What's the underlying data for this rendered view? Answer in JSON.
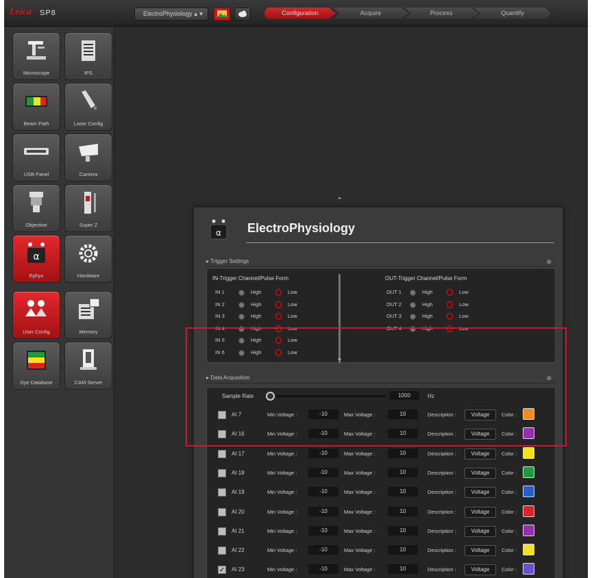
{
  "topbar": {
    "brand": "Leica",
    "model": "SP8",
    "project": "ElectroPhysiology",
    "tabs": [
      "Configuration",
      "Acquire",
      "Process",
      "Quantify"
    ],
    "icons": {
      "photo": "photo-icon",
      "cloud": "cloud-icon"
    }
  },
  "sidebar": {
    "tiles": [
      {
        "label": "Microscope",
        "icon": "microscope-icon"
      },
      {
        "label": "IPS",
        "icon": "list-icon"
      },
      {
        "label": "Beam Path",
        "icon": "beam-path-icon"
      },
      {
        "label": "Laser Config",
        "icon": "laser-icon"
      },
      {
        "label": "USB Panel",
        "icon": "usb-panel-icon"
      },
      {
        "label": "Camera",
        "icon": "camera-icon"
      },
      {
        "label": "Objective",
        "icon": "objective-icon"
      },
      {
        "label": "Super Z",
        "icon": "super-z-icon"
      },
      {
        "label": "Ephys",
        "icon": "ephys-icon",
        "active": true
      },
      {
        "label": "Hardware",
        "icon": "gear-icon"
      },
      {
        "label": "User Config",
        "icon": "user-config-icon",
        "active": true
      },
      {
        "label": "Memory",
        "icon": "memory-icon"
      },
      {
        "label": "Dye Database",
        "icon": "dye-database-icon"
      },
      {
        "label": "CAM Server",
        "icon": "cam-server-icon"
      }
    ]
  },
  "panel": {
    "title": "ElectroPhysiology",
    "trigger": {
      "heading": "Trigger Settings",
      "in_title": "IN-Trigger Channel/Pulse Form",
      "out_title": "OUT-Trigger Channel/Pulse Form",
      "high_label": "High",
      "low_label": "Low",
      "in_channels": [
        "IN 1",
        "IN 2",
        "IN 3",
        "IN 4",
        "IN 5",
        "IN 6"
      ],
      "out_channels": [
        "OUT 1",
        "OUT 2",
        "OUT 3",
        "OUT 4"
      ]
    },
    "data": {
      "heading": "Data Acquisition",
      "sample_rate_label": "Sample Rate",
      "sample_rate_value": "1000",
      "sample_rate_unit": "Hz",
      "min_label": "Min Voltage :",
      "max_label": "Max Voltage :",
      "desc_label": "Description :",
      "color_label": "Color :",
      "rows": [
        {
          "name": "AI 7",
          "min": "-10",
          "max": "10",
          "desc": "Voltage",
          "color": "#f28a1e",
          "checked": false
        },
        {
          "name": "AI 16",
          "min": "-10",
          "max": "10",
          "desc": "Voltage",
          "color": "#9a2bb5",
          "checked": false
        },
        {
          "name": "AI 17",
          "min": "-10",
          "max": "10",
          "desc": "Voltage",
          "color": "#f4e21a",
          "checked": false
        },
        {
          "name": "AI 18",
          "min": "-10",
          "max": "10",
          "desc": "Voltage",
          "color": "#1e9a3c",
          "checked": false
        },
        {
          "name": "AI 19",
          "min": "-10",
          "max": "10",
          "desc": "Voltage",
          "color": "#2a5fc9",
          "checked": false
        },
        {
          "name": "AI 20",
          "min": "-10",
          "max": "10",
          "desc": "Voltage",
          "color": "#e02222",
          "checked": false
        },
        {
          "name": "AI 21",
          "min": "-10",
          "max": "10",
          "desc": "Voltage",
          "color": "#9a2bb5",
          "checked": false
        },
        {
          "name": "AI 22",
          "min": "-10",
          "max": "10",
          "desc": "Voltage",
          "color": "#f4e21a",
          "checked": false
        },
        {
          "name": "AI 23",
          "min": "-10",
          "max": "10",
          "desc": "Voltage",
          "color": "#6a4fd0",
          "checked": true
        }
      ]
    }
  },
  "colors": {
    "accent": "#c41a1a",
    "highlight": "#d4152a"
  }
}
